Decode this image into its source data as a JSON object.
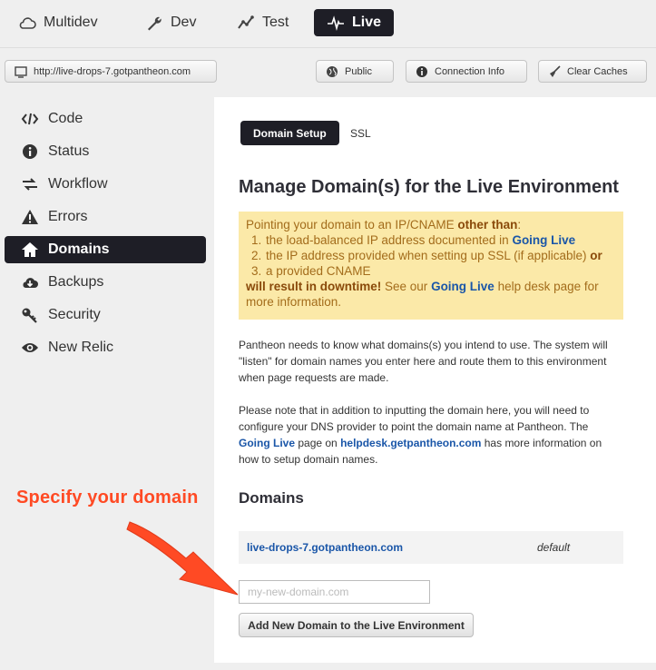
{
  "env_tabs": [
    {
      "label": "Multidev",
      "icon": "cloud-icon"
    },
    {
      "label": "Dev",
      "icon": "wrench-icon"
    },
    {
      "label": "Test",
      "icon": "line-chart-icon"
    },
    {
      "label": "Live",
      "icon": "pulse-icon",
      "active": true
    }
  ],
  "toolbar": {
    "url": "http://live-drops-7.gotpantheon.com",
    "public_label": "Public",
    "connection_label": "Connection Info",
    "clear_caches_label": "Clear Caches"
  },
  "sidebar": {
    "items": [
      {
        "label": "Code",
        "icon": "code-icon"
      },
      {
        "label": "Status",
        "icon": "info-icon"
      },
      {
        "label": "Workflow",
        "icon": "arrows-icon"
      },
      {
        "label": "Errors",
        "icon": "warning-icon"
      },
      {
        "label": "Domains",
        "icon": "home-icon",
        "active": true
      },
      {
        "label": "Backups",
        "icon": "cloud-download-icon"
      },
      {
        "label": "Security",
        "icon": "key-icon"
      },
      {
        "label": "New Relic",
        "icon": "eye-icon"
      }
    ]
  },
  "main": {
    "tabs": [
      {
        "label": "Domain Setup",
        "active": true
      },
      {
        "label": "SSL"
      }
    ],
    "title": "Manage Domain(s) for the Live Environment",
    "warning": {
      "intro": "Pointing your domain to an IP/CNAME ",
      "intro_bold": "other than",
      "intro_end": ":",
      "items": [
        {
          "num": "1.",
          "text": "the load-balanced IP address documented in ",
          "link": "Going Live",
          "tail": ""
        },
        {
          "num": "2.",
          "text": "the IP address provided when setting up SSL (if applicable) ",
          "link": "",
          "tail": "or"
        },
        {
          "num": "3.",
          "text": "a provided CNAME",
          "link": "",
          "tail": ""
        }
      ],
      "downtime": "will result in downtime!",
      "see_our": " See our ",
      "link": "Going Live",
      "rest": " help desk page for more information."
    },
    "para1": "Pantheon needs to know what domains(s) you intend to use. The system will \"listen\" for domain names you enter here and route them to this environment when page requests are made.",
    "para2_a": "Please note that in addition to inputting the domain here, you will need to configure your DNS provider to point the domain name at Pantheon. The ",
    "para2_link1": "Going Live",
    "para2_b": " page on ",
    "para2_link2": "helpdesk.getpantheon.com",
    "para2_c": " has more information on how to setup domain names.",
    "domains_title": "Domains",
    "domain_rows": [
      {
        "domain": "live-drops-7.gotpantheon.com",
        "status": "default"
      }
    ],
    "input_placeholder": "my-new-domain.com",
    "add_button": "Add New Domain to the Live Environment"
  },
  "annotation": {
    "text": "Specify your domain",
    "color": "#ff4a24"
  },
  "colors": {
    "active_bg": "#1e1e26",
    "link": "#1a56a8",
    "warning_bg": "#fbe9a8",
    "warning_text": "#a36c1b"
  }
}
